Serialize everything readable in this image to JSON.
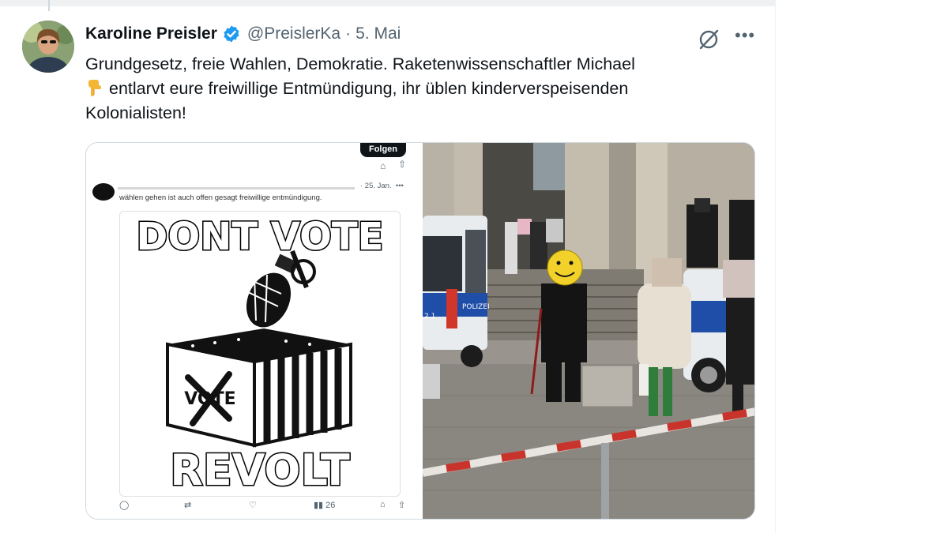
{
  "tweet": {
    "display_name": "Karoline Preisler",
    "handle": "@PreislerKa",
    "separator": "·",
    "date": "5. Mai",
    "more": "•••",
    "line1": "Grundgesetz, freie Wahlen, Demokratie. Raketenwissenschaftler Michael",
    "line2": "entlarvt eure freiwillige Entmündigung, ihr üblen kinderverspeisenden",
    "line3": "Kolonialisten!",
    "icons": {
      "verified": "verified-badge-icon",
      "grok": "grok-icon",
      "more": "more-icon",
      "hand": "pointing-down-hand-emoji"
    },
    "colors": {
      "verified": "#1d9bf0",
      "text": "#0f1419",
      "muted": "#536471"
    }
  },
  "media": {
    "screenshot": {
      "follow_label": "Folgen",
      "date": "· 25. Jan.",
      "dots": "•••",
      "text": "wählen gehen ist auch offen gesagt freiwillige entmündigung.",
      "poster_top": "DONT VOTE",
      "poster_bottom": "REVOLT",
      "ballot_text": "VOTE",
      "views": "26"
    },
    "photo": {
      "police_text": "POLIZEI",
      "car_number": "2.1"
    }
  }
}
